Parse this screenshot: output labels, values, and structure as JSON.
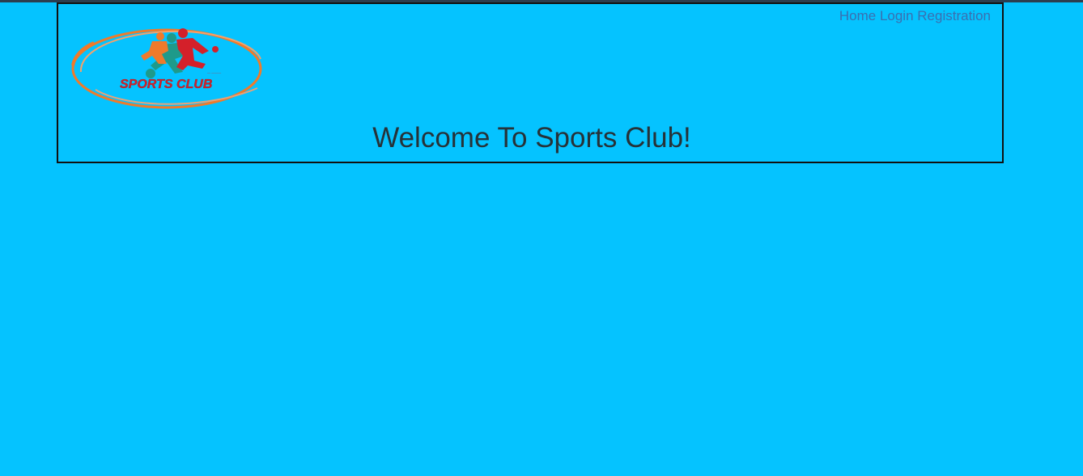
{
  "nav": {
    "home": "Home",
    "login": "Login",
    "registration": "Registration"
  },
  "logo": {
    "text": "SPORTS CLUB",
    "colors": {
      "ring": "#f07a2a",
      "figure_left": "#1e9a8a",
      "figure_right": "#d4202a",
      "text": "#d4202a"
    }
  },
  "main": {
    "heading": "Welcome To Sports Club!"
  },
  "colors": {
    "background": "#05c3ff",
    "border": "#111111",
    "link": "#3a6fb0",
    "heading": "#263238"
  }
}
